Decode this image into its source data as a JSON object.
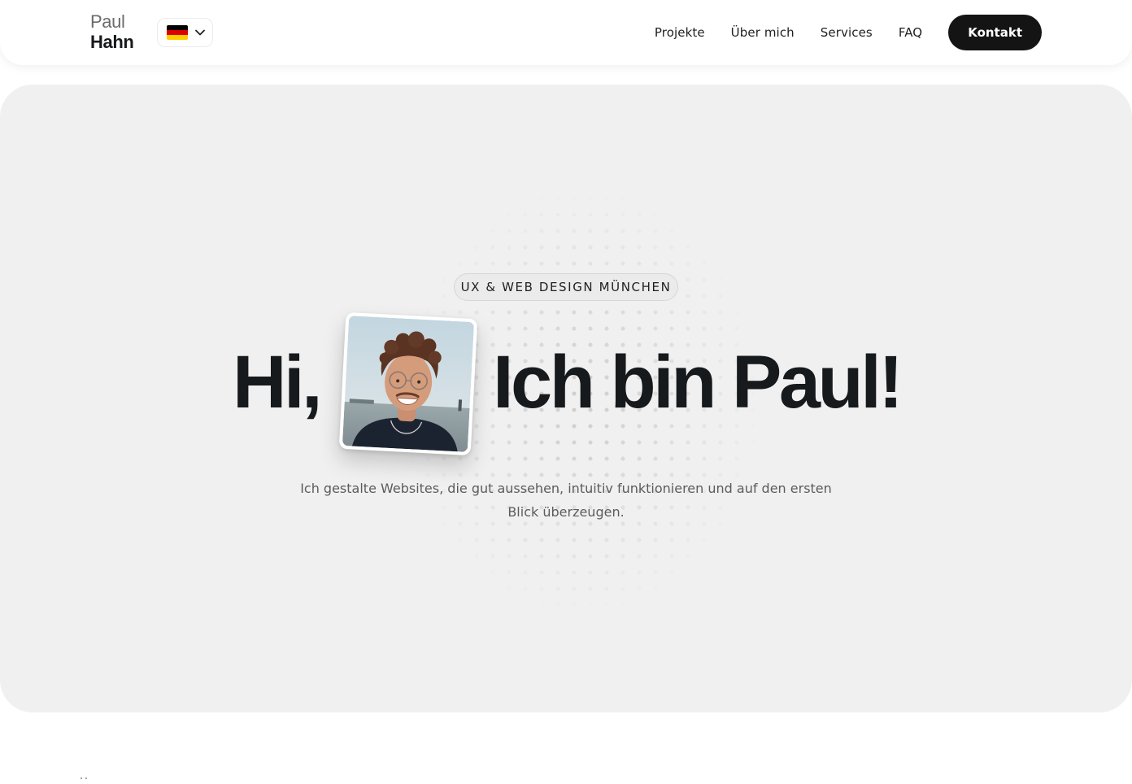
{
  "header": {
    "logo": {
      "line1": "Paul",
      "line2": "Hahn"
    },
    "language": {
      "selected": "de",
      "flag_icon": "germany-flag-icon",
      "colors": [
        "#000000",
        "#dd0000",
        "#ffce00"
      ]
    },
    "nav": [
      {
        "label": "Projekte"
      },
      {
        "label": "Über mich"
      },
      {
        "label": "Services"
      },
      {
        "label": "FAQ"
      }
    ],
    "cta_label": "Kontakt"
  },
  "hero": {
    "badge": "UX & WEB DESIGN MÜNCHEN",
    "headline_part1": "Hi,",
    "headline_part2": "Ich bin Paul!",
    "photo_alt": "Portrait von Paul",
    "subline_1": "Ich gestalte Websites, die gut aussehen, intuitiv funktionieren und auf den ersten",
    "subline_2": "Blick überzeugen."
  },
  "colors": {
    "text": "#171a1d",
    "hero_bg": "#f0f0f0",
    "cta_bg": "#141414",
    "cta_text": "#ffffff",
    "muted": "#5a5c5e"
  }
}
